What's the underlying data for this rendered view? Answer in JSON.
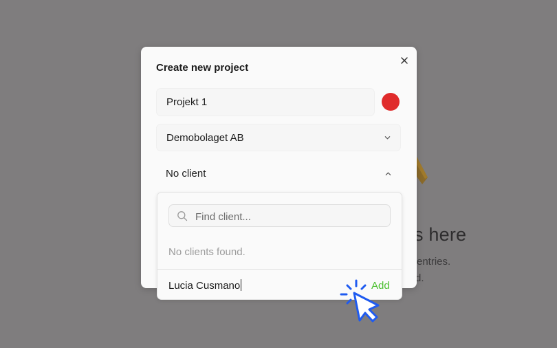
{
  "background": {
    "heading_partial": "s here",
    "line1_partial": "entries.",
    "line2_partial": "d."
  },
  "modal": {
    "title": "Create new project",
    "project_name": "Projekt 1",
    "project_color": "#e02b2b",
    "company": "Demobolaget AB",
    "client_select": "No client",
    "close_icon": "close-icon"
  },
  "client_dropdown": {
    "search_placeholder": "Find client...",
    "empty_message": "No clients found.",
    "new_client_value": "Lucia Cusmano",
    "add_label": "Add",
    "add_color": "#4bbf2f"
  },
  "cursor": {
    "icon": "click-pointer-icon",
    "color": "#1f5bf0"
  }
}
